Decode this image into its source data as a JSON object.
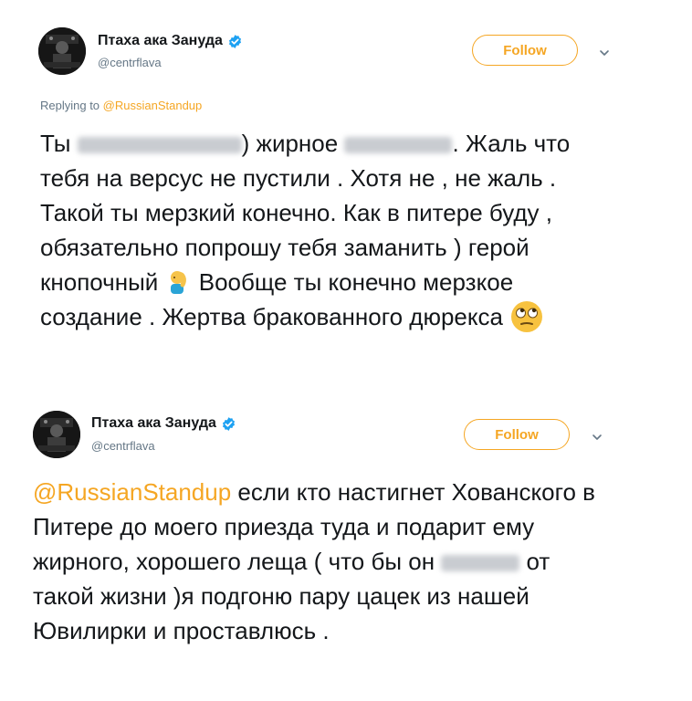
{
  "tweets": [
    {
      "author": {
        "display_name": "Птаха ака Зануда",
        "handle": "@centrflava",
        "verified_icon": "verified-badge-icon"
      },
      "follow_label": "Follow",
      "replying_to_prefix": "Replying to",
      "replying_to_mention": "@RussianStandup",
      "text": {
        "p1": "Ты",
        "p2": ") жирное",
        "p3": ". Жаль что тебя на версус не пустили . Хотя не , не жаль . Такой ты мерзкий конечно.  Как в питере буду , обязательно попрошу тебя заманить ) герой кнопочный",
        "p4": "Вообще ты конечно мерзкое создание . Жертва бракованного дюрекса",
        "emoji_1": "facepalm-emoji",
        "emoji_2": "eye-roll-emoji"
      }
    },
    {
      "author": {
        "display_name": "Птаха ака Зануда",
        "handle": "@centrflava",
        "verified_icon": "verified-badge-icon"
      },
      "follow_label": "Follow",
      "text": {
        "mention": "@RussianStandup",
        "p1": " если кто настигнет Хованского в Питере до моего приезда туда и подарит ему жирного, хорошего леща ( что бы он",
        "p2": "от такой жизни )я подгоню пару цацек из нашей Ювилирки и проставлюсь ."
      }
    }
  ],
  "colors": {
    "accent": "#f5a623",
    "verified": "#1da1f2",
    "text": "#14171a",
    "muted": "#657786"
  }
}
